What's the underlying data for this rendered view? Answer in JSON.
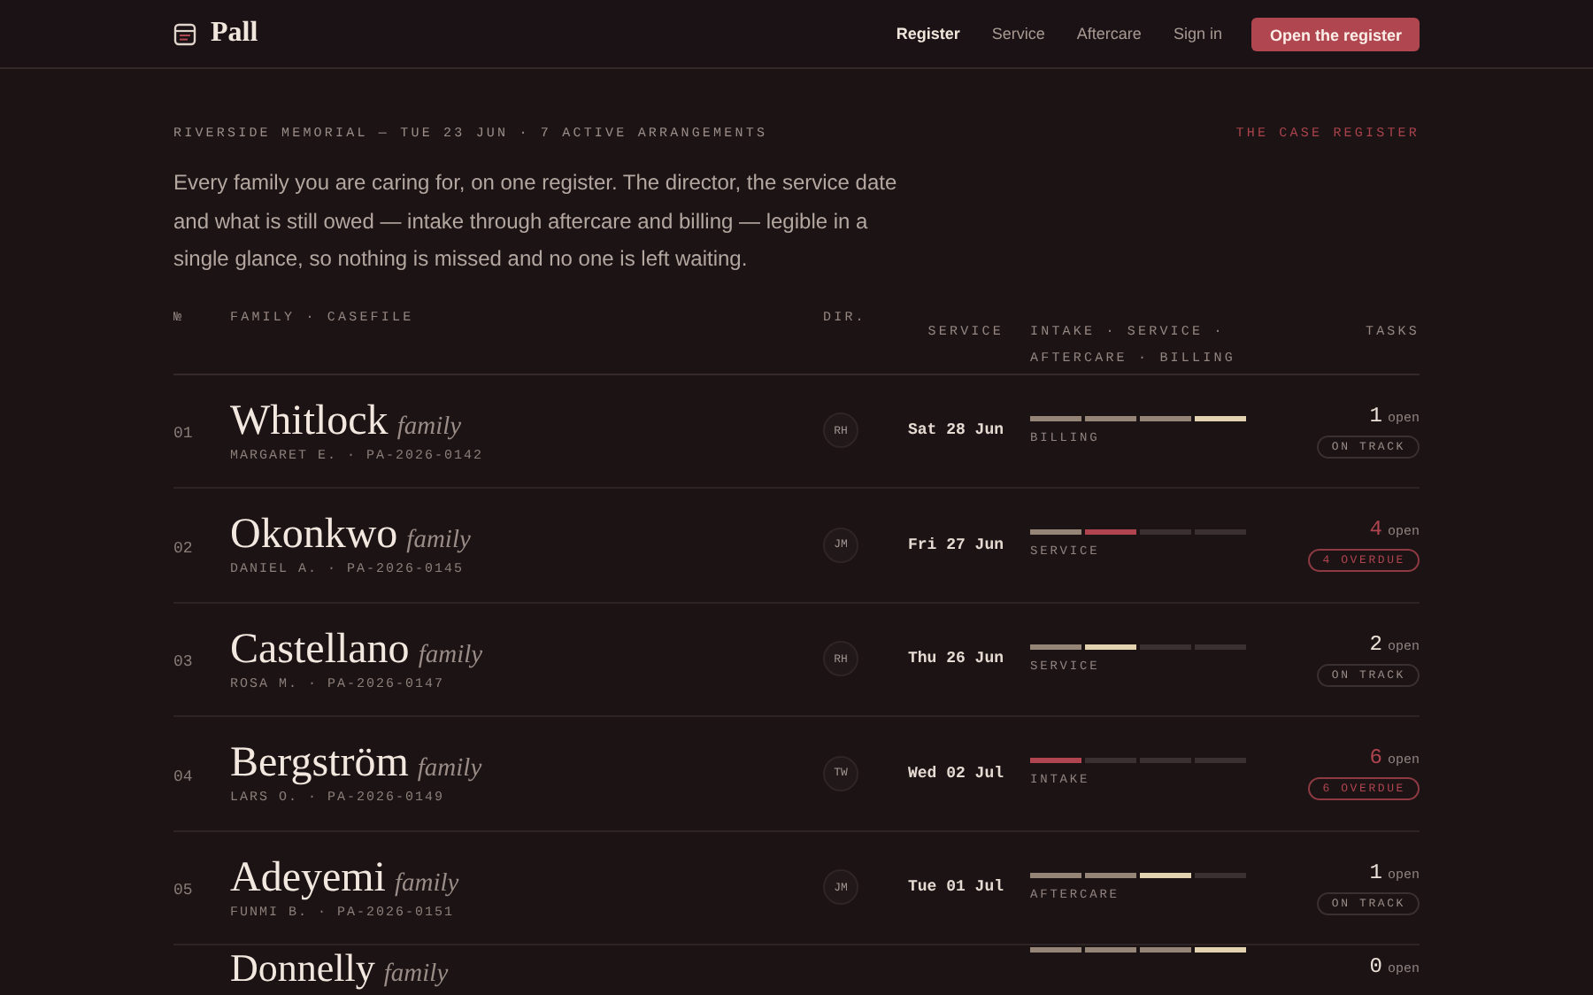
{
  "brand": {
    "name": "Pall"
  },
  "nav": [
    {
      "label": "Register",
      "selected": true
    },
    {
      "label": "Service",
      "selected": false
    },
    {
      "label": "Aftercare",
      "selected": false
    },
    {
      "label": "Sign in",
      "selected": false
    }
  ],
  "cta": "Open the register",
  "eyebrow": "RIVERSIDE MEMORIAL — TUE 23 JUN · 7 ACTIVE ARRANGEMENTS",
  "section_label": "THE CASE REGISTER",
  "intro": "Every family you are caring for, on one register. The director, the service date and what is still owed — intake through aftercare and billing — legible in a single glance, so nothing is missed and no one is left waiting.",
  "columns": [
    "№",
    "FAMILY · CASEFILE",
    "DIR.",
    "SERVICE",
    "INTAKE · SERVICE · AFTERCARE · BILLING",
    "TASKS"
  ],
  "rows": [
    {
      "number": "01",
      "name": "Whitlock",
      "suffix": "family",
      "casefile": "MARGARET E. · PA-2026-0142",
      "director": "RH",
      "service": "Sat 28 Jun",
      "stages": [
        {
          "kind": "done"
        },
        {
          "kind": "done"
        },
        {
          "kind": "done"
        },
        {
          "kind": "current"
        }
      ],
      "stage_label": "BILLING",
      "tasks": "1",
      "tasks_unit": "open",
      "overdue": false,
      "status_label": "ON TRACK"
    },
    {
      "number": "02",
      "name": "Okonkwo",
      "suffix": "family",
      "casefile": "DANIEL A. · PA-2026-0145",
      "director": "JM",
      "service": "Fri 27 Jun",
      "stages": [
        {
          "kind": "done"
        },
        {
          "kind": "overdue"
        },
        {
          "kind": "pending"
        },
        {
          "kind": "pending"
        }
      ],
      "stage_label": "SERVICE",
      "tasks": "4",
      "tasks_unit": "open",
      "overdue": true,
      "status_label": "4 OVERDUE"
    },
    {
      "number": "03",
      "name": "Castellano",
      "suffix": "family",
      "casefile": "ROSA M. · PA-2026-0147",
      "director": "RH",
      "service": "Thu 26 Jun",
      "stages": [
        {
          "kind": "done"
        },
        {
          "kind": "current"
        },
        {
          "kind": "pending"
        },
        {
          "kind": "pending"
        }
      ],
      "stage_label": "SERVICE",
      "tasks": "2",
      "tasks_unit": "open",
      "overdue": false,
      "status_label": "ON TRACK"
    },
    {
      "number": "04",
      "name": "Bergström",
      "suffix": "family",
      "casefile": "LARS O. · PA-2026-0149",
      "director": "TW",
      "service": "Wed 02 Jul",
      "stages": [
        {
          "kind": "overdue"
        },
        {
          "kind": "pending"
        },
        {
          "kind": "pending"
        },
        {
          "kind": "pending"
        }
      ],
      "stage_label": "INTAKE",
      "tasks": "6",
      "tasks_unit": "open",
      "overdue": true,
      "status_label": "6 OVERDUE"
    },
    {
      "number": "05",
      "name": "Adeyemi",
      "suffix": "family",
      "casefile": "FUNMI B. · PA-2026-0151",
      "director": "JM",
      "service": "Tue 01 Jul",
      "stages": [
        {
          "kind": "done"
        },
        {
          "kind": "done"
        },
        {
          "kind": "current"
        },
        {
          "kind": "pending"
        }
      ],
      "stage_label": "AFTERCARE",
      "tasks": "1",
      "tasks_unit": "open",
      "overdue": false,
      "status_label": "ON TRACK"
    },
    {
      "name": "Donnelly",
      "suffix": "family",
      "stages": [
        {
          "kind": "done"
        },
        {
          "kind": "done"
        },
        {
          "kind": "done"
        },
        {
          "kind": "current"
        }
      ],
      "tasks": "0",
      "tasks_unit": "open",
      "overdue": false
    }
  ]
}
